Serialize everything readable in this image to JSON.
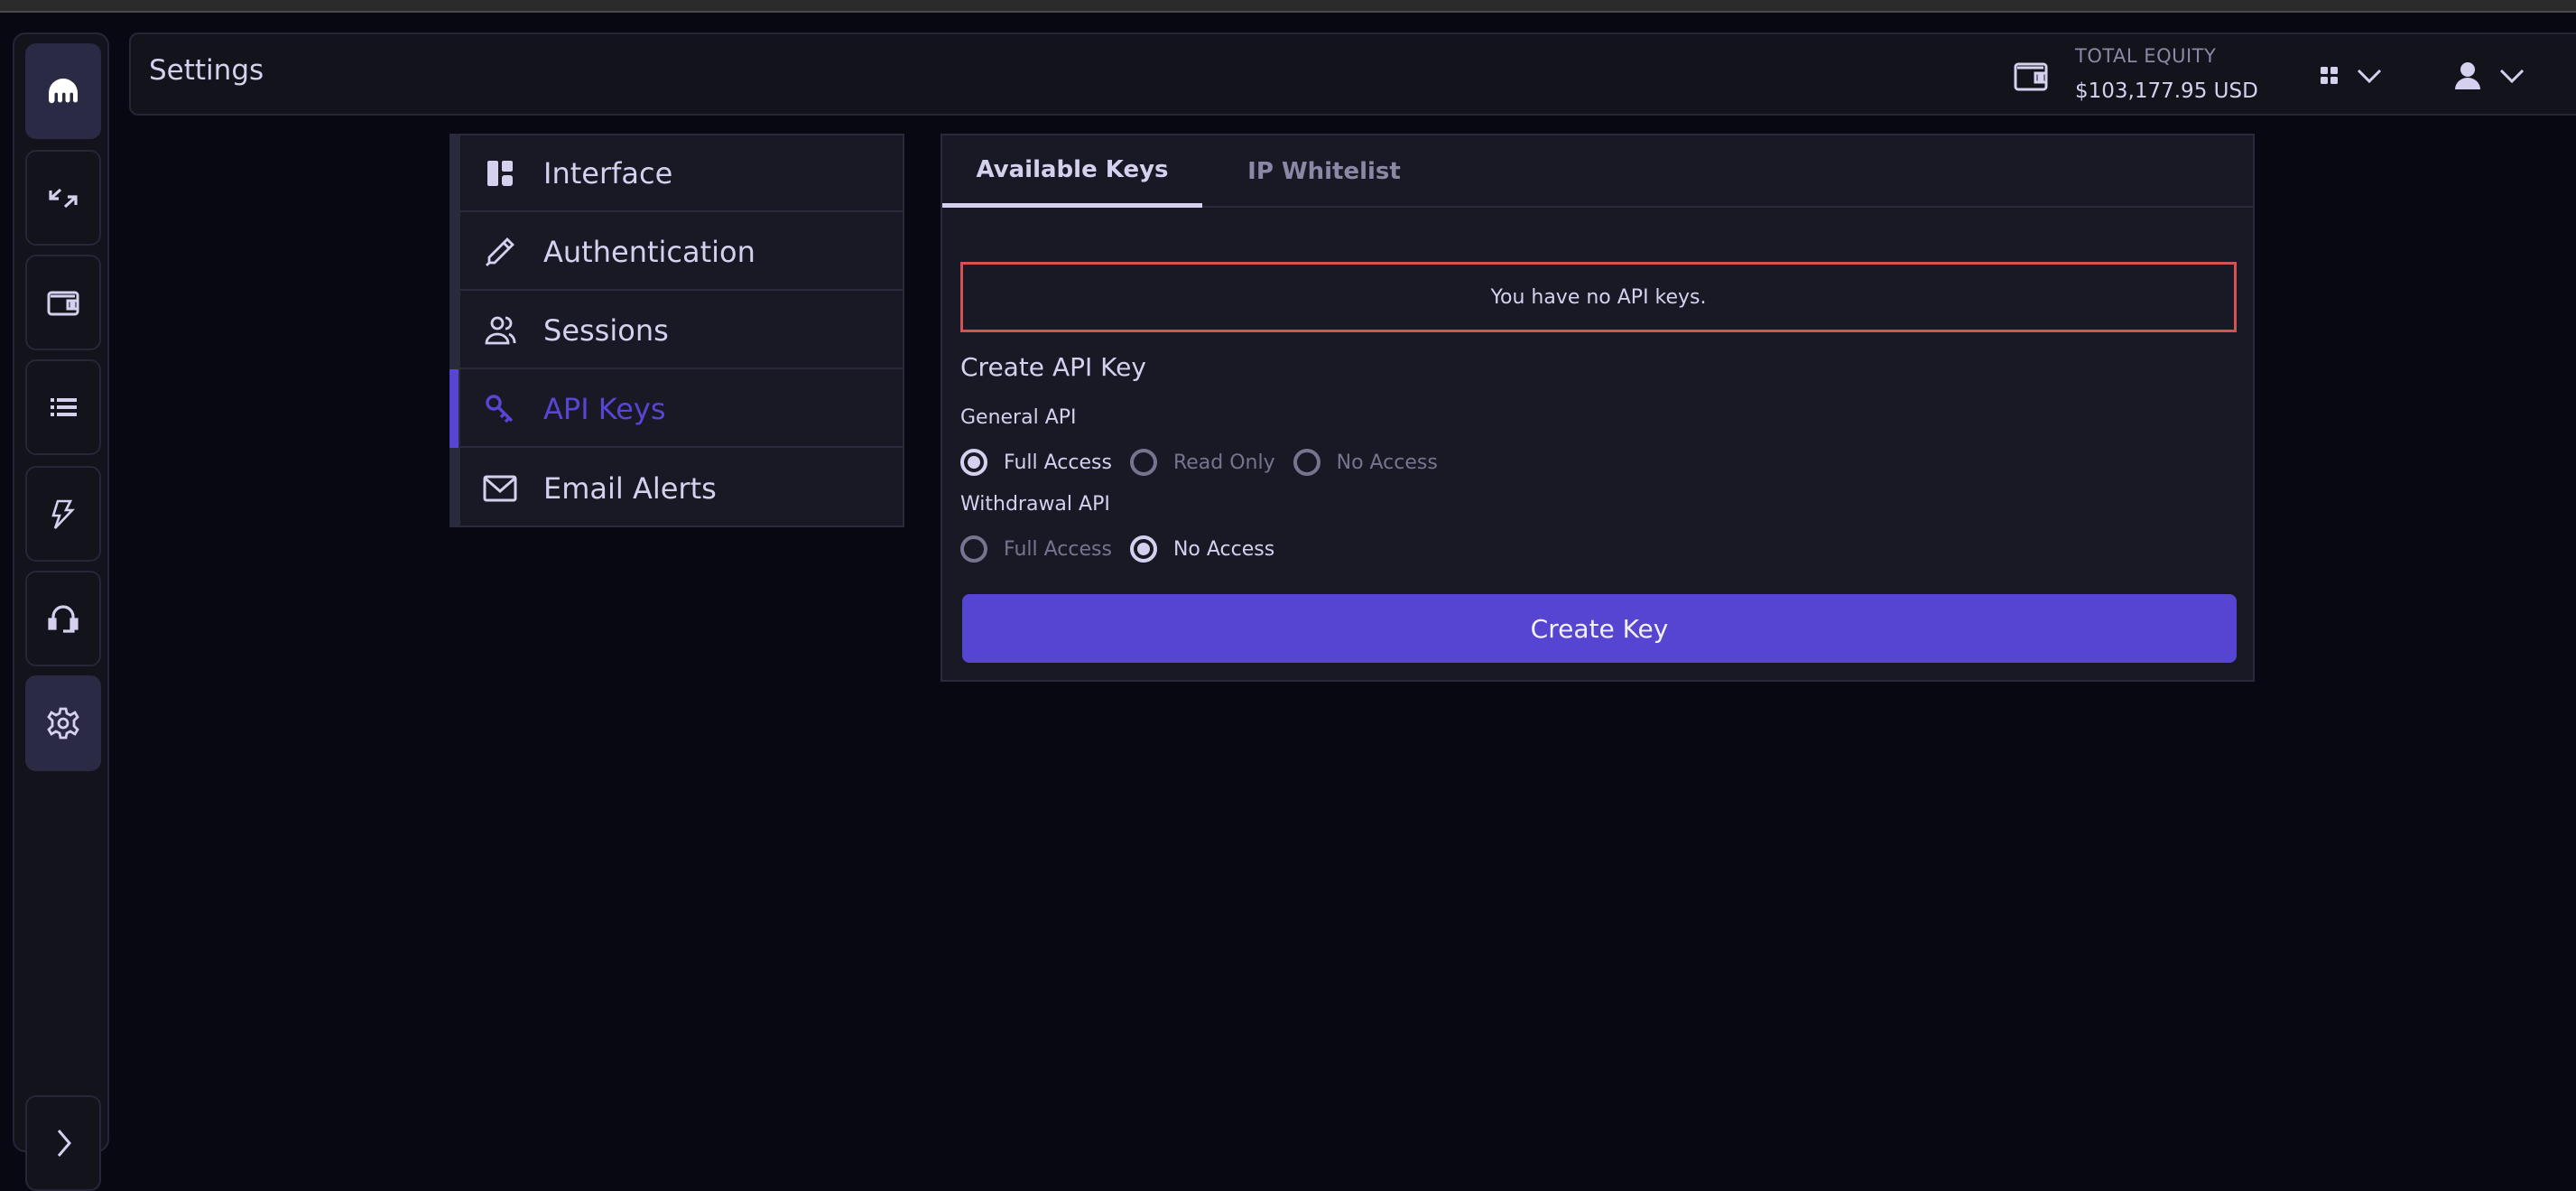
{
  "header": {
    "title": "Settings",
    "equity_label": "TOTAL EQUITY",
    "equity_value": "$103,177.95 USD"
  },
  "rail": {
    "items": [
      {
        "icon": "kraken-logo-icon",
        "active": true
      },
      {
        "icon": "trade-arrows-icon",
        "active": false
      },
      {
        "icon": "wallet-icon",
        "active": false
      },
      {
        "icon": "list-icon",
        "active": false
      },
      {
        "icon": "lightning-icon",
        "active": false
      },
      {
        "icon": "headset-icon",
        "active": false
      },
      {
        "icon": "gear-icon",
        "active": true
      },
      {
        "icon": "expand-chevron-icon",
        "active": false
      }
    ]
  },
  "settings_menu": {
    "items": [
      {
        "label": "Interface",
        "icon": "layout-icon",
        "active": false
      },
      {
        "label": "Authentication",
        "icon": "pen-icon",
        "active": false
      },
      {
        "label": "Sessions",
        "icon": "users-icon",
        "active": false
      },
      {
        "label": "API Keys",
        "icon": "key-icon",
        "active": true
      },
      {
        "label": "Email Alerts",
        "icon": "mail-icon",
        "active": false
      }
    ]
  },
  "panel": {
    "tabs": [
      {
        "label": "Available Keys",
        "active": true
      },
      {
        "label": "IP Whitelist",
        "active": false
      }
    ],
    "empty_message": "You have no API keys.",
    "create_title": "Create API Key",
    "general_api": {
      "label": "General API",
      "options": [
        {
          "label": "Full Access",
          "checked": true
        },
        {
          "label": "Read Only",
          "checked": false
        },
        {
          "label": "No Access",
          "checked": false
        }
      ]
    },
    "withdrawal_api": {
      "label": "Withdrawal API",
      "options": [
        {
          "label": "Full Access",
          "checked": false
        },
        {
          "label": "No Access",
          "checked": true
        }
      ]
    },
    "create_button": "Create Key"
  },
  "colors": {
    "accent": "#5545d0",
    "alert_border": "#d45253",
    "background": "#080813",
    "panel": "#191925",
    "text": "#d4d0ee"
  }
}
